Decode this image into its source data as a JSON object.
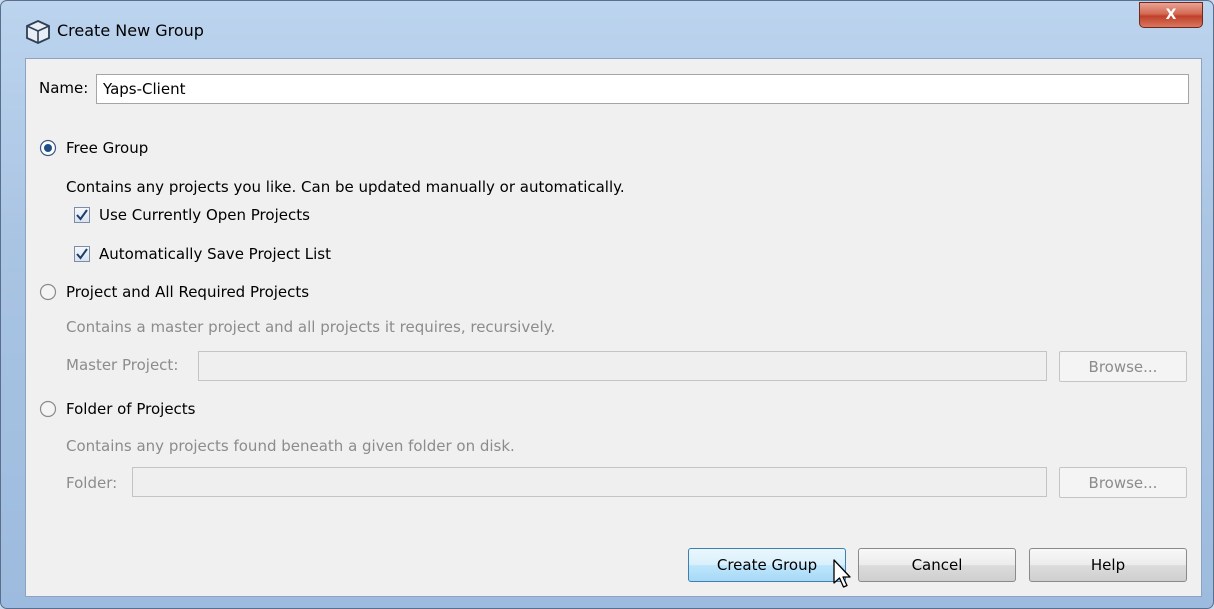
{
  "window": {
    "title": "Create New Group",
    "close_glyph": "X"
  },
  "name_field": {
    "label": "Name:",
    "value": "Yaps-Client"
  },
  "free_group": {
    "label": "Free Group",
    "description": "Contains any projects you like. Can be updated manually or automatically.",
    "selected": true,
    "use_open_projects": {
      "label": "Use Currently Open Projects",
      "checked": true
    },
    "auto_save": {
      "label": "Automatically Save Project List",
      "checked": true
    }
  },
  "project_group": {
    "label": "Project and All Required Projects",
    "description": "Contains a master project and all projects it requires, recursively.",
    "selected": false,
    "field_label": "Master Project:",
    "browse_label": "Browse..."
  },
  "folder_group": {
    "label": "Folder of Projects",
    "description": "Contains any projects found beneath a given folder on disk.",
    "selected": false,
    "field_label": "Folder:",
    "browse_label": "Browse..."
  },
  "buttons": {
    "create": "Create Group",
    "cancel": "Cancel",
    "help": "Help"
  },
  "icons": {
    "window": "netbeans-cube-icon",
    "close": "close-icon",
    "radio_selected": "radio-selected-icon",
    "radio_unselected": "radio-unselected-icon",
    "checkbox": "checkmark-icon",
    "cursor": "mouse-pointer-icon"
  }
}
